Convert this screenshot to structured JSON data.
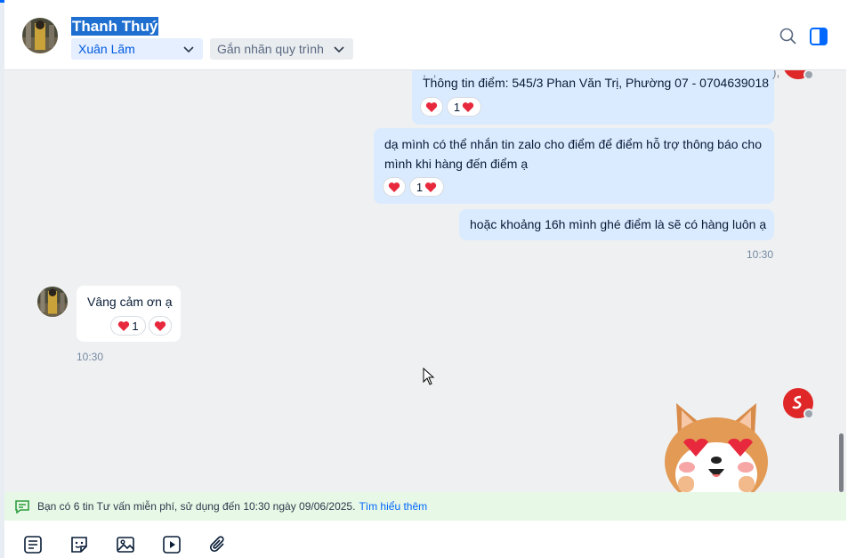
{
  "header": {
    "contact_name": "Thanh Thuý",
    "assignee_tag": "Xuân Lãm",
    "process_tag": "Gắn nhãn quy trình",
    "icons": [
      "search-icon",
      "toggle-panel-icon"
    ]
  },
  "messages": {
    "m1_text": "Thông tin điểm: 545/3 Phan Văn Trị, Phường 07 - 0704639018",
    "m1_react_count": "1",
    "m2_text_line1": "dạ mình có thể nhắn tin zalo cho điểm để điểm hỗ trợ thông báo cho",
    "m2_text_line2": "mình khi hàng đến điểm ạ",
    "m2_react_count": "1",
    "m3_text": "hoặc khoảng 16h mình ghé điểm là sẽ có hàng luôn ạ",
    "m3_time": "10:30",
    "m4_text": "Vâng cảm ơn ạ",
    "m4_react_count": "1",
    "m4_time": "10:30",
    "sticker": "shiba-heart-eyes-sticker"
  },
  "notice": {
    "text": "Bạn có 6 tin Tư vấn miễn phí, sử dụng đến 10:30 ngày 09/06/2025.",
    "link": "Tìm hiểu thêm"
  },
  "toolbar": {
    "icons": [
      "quick-message-icon",
      "sticker-icon",
      "image-icon",
      "video-icon",
      "attachment-icon"
    ]
  },
  "colors": {
    "accent": "#0068ff",
    "my_bubble": "#dbebff",
    "their_bubble": "#ffffff",
    "chat_bg": "#eef0f1",
    "notice_bg": "#e7f8e6",
    "brand_red": "#e02727"
  }
}
